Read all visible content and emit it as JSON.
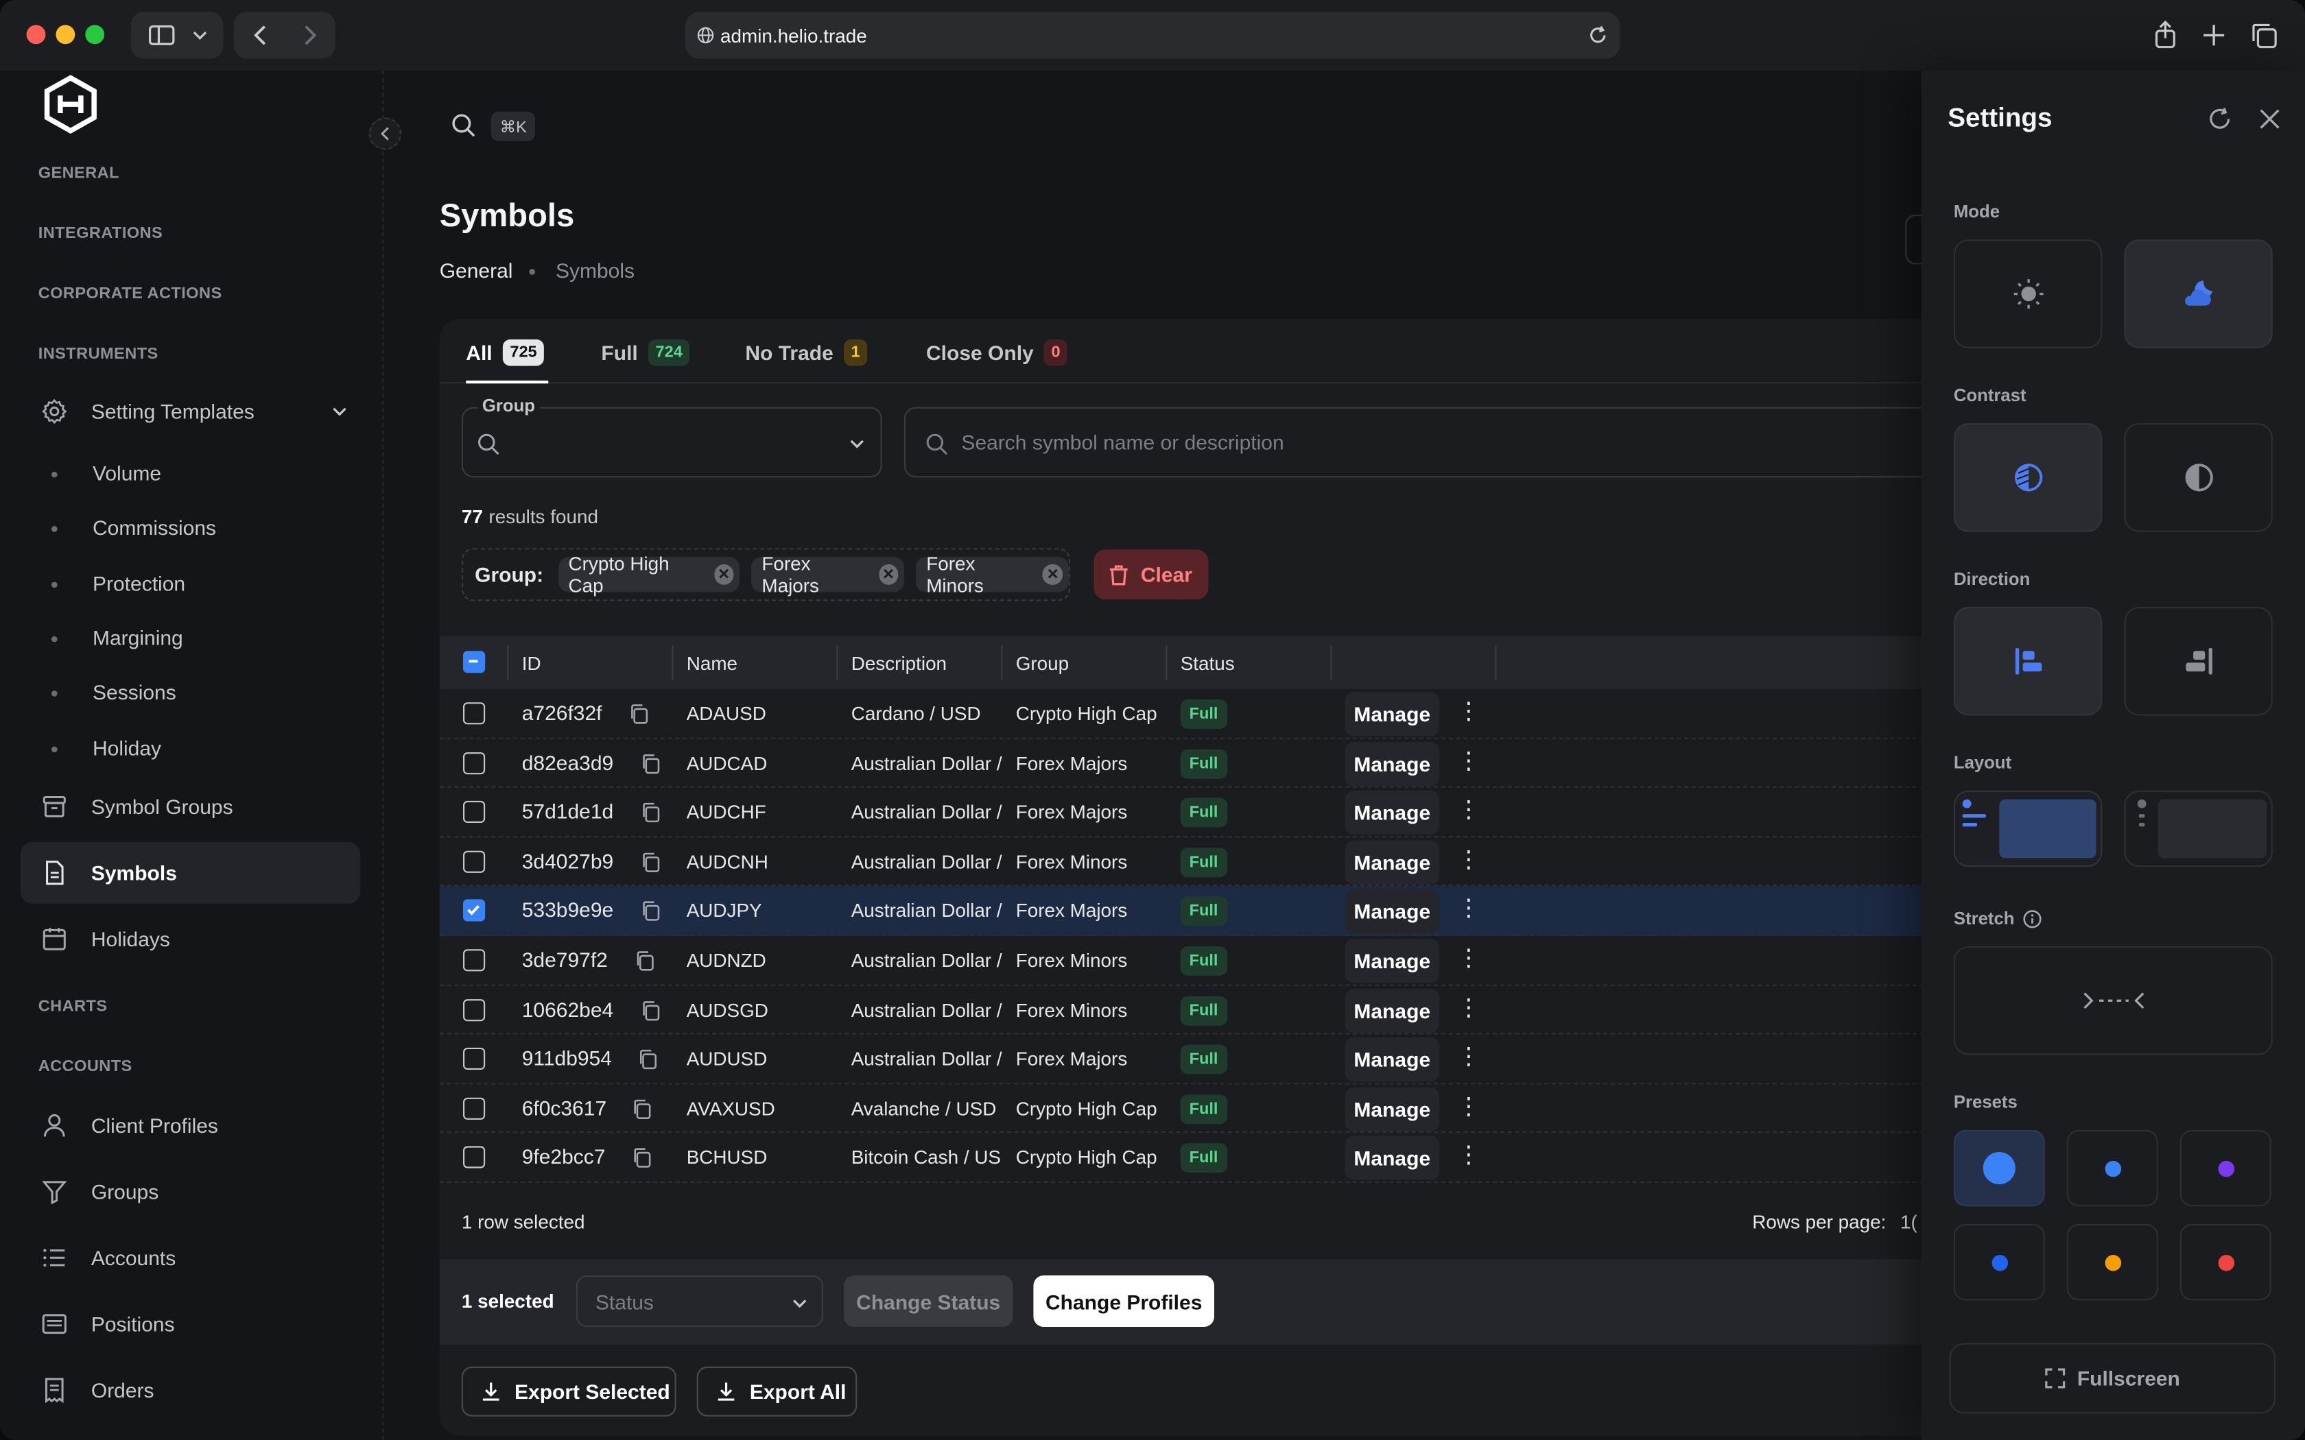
{
  "browser": {
    "url": "admin.helio.trade"
  },
  "sidebar": {
    "sections": {
      "general": "GENERAL",
      "integrations": "INTEGRATIONS",
      "corporate_actions": "CORPORATE ACTIONS",
      "instruments": "INSTRUMENTS",
      "charts": "CHARTS",
      "accounts": "ACCOUNTS"
    },
    "setting_templates": "Setting Templates",
    "sub_items": [
      "Volume",
      "Commissions",
      "Protection",
      "Margining",
      "Sessions",
      "Holiday"
    ],
    "symbol_groups": "Symbol Groups",
    "symbols": "Symbols",
    "holidays": "Holidays",
    "client_profiles": "Client Profiles",
    "groups": "Groups",
    "accounts": "Accounts",
    "positions": "Positions",
    "orders": "Orders"
  },
  "main": {
    "shortcut": "⌘K",
    "title": "Symbols",
    "breadcrumb": [
      "General",
      "Symbols"
    ],
    "tabs": [
      {
        "label": "All",
        "count": "725"
      },
      {
        "label": "Full",
        "count": "724"
      },
      {
        "label": "No Trade",
        "count": "1"
      },
      {
        "label": "Close Only",
        "count": "0"
      }
    ],
    "group_label": "Group",
    "search_placeholder": "Search symbol name or description",
    "results_count": "77",
    "results_text": "results found",
    "filter_key": "Group:",
    "filter_chips": [
      "Crypto High Cap",
      "Forex Majors",
      "Forex Minors"
    ],
    "clear_label": "Clear",
    "columns": [
      "ID",
      "Name",
      "Description",
      "Group",
      "Status"
    ],
    "rows": [
      {
        "id": "a726f32f",
        "name": "ADAUSD",
        "description": "Cardano / USD",
        "group": "Crypto High Cap",
        "status": "Full",
        "selected": false
      },
      {
        "id": "d82ea3d9",
        "name": "AUDCAD",
        "description": "Australian Dollar /",
        "group": "Forex Majors",
        "status": "Full",
        "selected": false
      },
      {
        "id": "57d1de1d",
        "name": "AUDCHF",
        "description": "Australian Dollar /",
        "group": "Forex Majors",
        "status": "Full",
        "selected": false
      },
      {
        "id": "3d4027b9",
        "name": "AUDCNH",
        "description": "Australian Dollar /",
        "group": "Forex Minors",
        "status": "Full",
        "selected": false
      },
      {
        "id": "533b9e9e",
        "name": "AUDJPY",
        "description": "Australian Dollar /",
        "group": "Forex Majors",
        "status": "Full",
        "selected": true
      },
      {
        "id": "3de797f2",
        "name": "AUDNZD",
        "description": "Australian Dollar /",
        "group": "Forex Minors",
        "status": "Full",
        "selected": false
      },
      {
        "id": "10662be4",
        "name": "AUDSGD",
        "description": "Australian Dollar /",
        "group": "Forex Minors",
        "status": "Full",
        "selected": false
      },
      {
        "id": "911db954",
        "name": "AUDUSD",
        "description": "Australian Dollar /",
        "group": "Forex Majors",
        "status": "Full",
        "selected": false
      },
      {
        "id": "6f0c3617",
        "name": "AVAXUSD",
        "description": "Avalanche / USD",
        "group": "Crypto High Cap",
        "status": "Full",
        "selected": false
      },
      {
        "id": "9fe2bcc7",
        "name": "BCHUSD",
        "description": "Bitcoin Cash / US",
        "group": "Crypto High Cap",
        "status": "Full",
        "selected": false
      }
    ],
    "manage_label": "Manage",
    "row_selected_text": "1 row selected",
    "rows_per_page": "Rows per page:",
    "rows_per_page_value": "1(",
    "bulk_count": "1 selected",
    "status_placeholder": "Status",
    "change_status": "Change Status",
    "change_profiles": "Change Profiles",
    "export_selected": "Export Selected",
    "export_all": "Export All"
  },
  "settings": {
    "title": "Settings",
    "mode": "Mode",
    "contrast": "Contrast",
    "direction": "Direction",
    "layout": "Layout",
    "stretch": "Stretch",
    "presets": "Presets",
    "preset_colors": [
      "#3b82f6",
      "#3b82f6",
      "#7c3aed",
      "#2563eb",
      "#f59e0b",
      "#ef4444"
    ],
    "fullscreen": "Fullscreen"
  },
  "colors": {
    "accent": "#3b82f6",
    "badge_all": "#e5e7eb",
    "badge_full": "#1f3b2d",
    "badge_notrade": "#4a3b13",
    "badge_closeonly": "#4a1f22"
  }
}
